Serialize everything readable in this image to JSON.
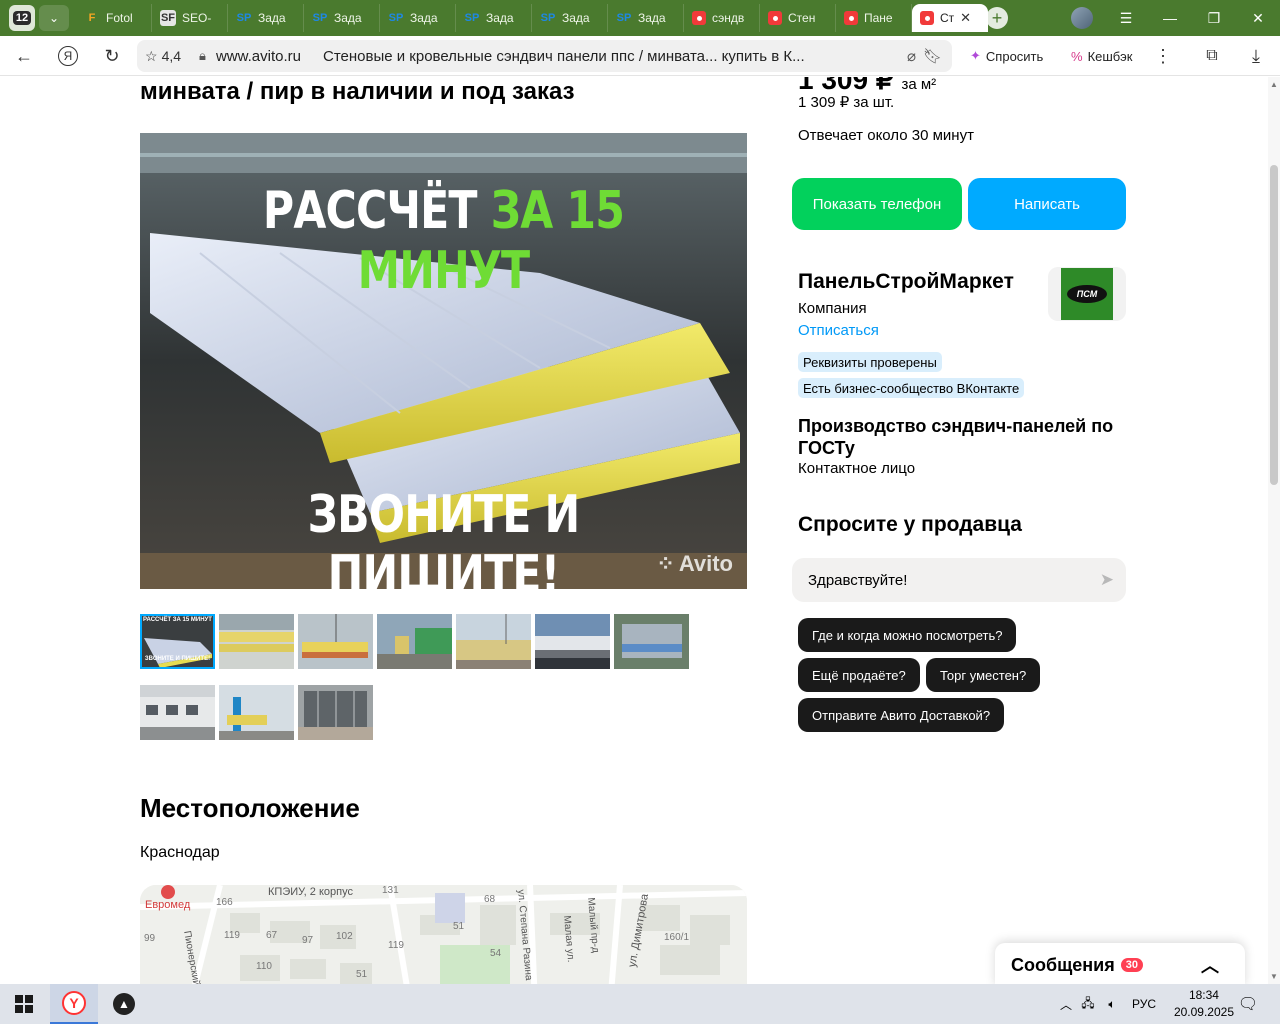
{
  "browser": {
    "tab_count": "12",
    "tabs": [
      {
        "label": "Fotol",
        "fav": "F"
      },
      {
        "label": "SEO-",
        "fav": "SF"
      },
      {
        "label": "Зада",
        "fav": "SP"
      },
      {
        "label": "Зада",
        "fav": "SP"
      },
      {
        "label": "Зада",
        "fav": "SP"
      },
      {
        "label": "Зада",
        "fav": "SP"
      },
      {
        "label": "Зада",
        "fav": "SP"
      },
      {
        "label": "Зада",
        "fav": "SP"
      },
      {
        "label": "сэндв",
        "fav": ""
      },
      {
        "label": "Стен",
        "fav": ""
      },
      {
        "label": "Пане",
        "fav": ""
      },
      {
        "label": "Ст",
        "fav": ""
      }
    ],
    "rating": "4,4",
    "domain": "www.avito.ru",
    "page_title": "Стеновые и кровельные сэндвич панели ппс / минвата... купить в К...",
    "ask_btn": "Спросить",
    "cashback_btn": "Кешбэк"
  },
  "listing": {
    "title_line": "минвата / пир в наличии и под заказ",
    "photo_text_top_white": "РАССЧЁТ",
    "photo_text_top_green": "ЗА 15 МИНУТ",
    "photo_text_bottom": "ЗВОНИТЕ И ПИШИТЕ!",
    "watermark": "Avito",
    "thumb_caption_1": "РАССЧЁТ ЗА 15 МИНУТ",
    "thumb_caption_2": "ЗВОНИТЕ И ПИШИТЕ!"
  },
  "location": {
    "heading": "Местоположение",
    "city": "Краснодар",
    "map_labels": [
      "Евромед",
      "КПЭИУ, 2 корпус",
      "Пионерский",
      "ул. Степана Разина",
      "Малая ул.",
      "Малый пр-д",
      "ул. Димитрова",
      "166",
      "131",
      "68",
      "99",
      "119",
      "67",
      "97",
      "102",
      "119",
      "51",
      "54",
      "110",
      "51",
      "160/1"
    ]
  },
  "sidebar": {
    "price_partial": "1 309 ₽",
    "price_unit_partial": "за м²",
    "price_per_item": "1 309 ₽ за шт.",
    "reply_time": "Отвечает около 30 минут",
    "phone_btn": "Показать телефон",
    "write_btn": "Написать",
    "seller_name": "ПанельСтройМаркет",
    "seller_type": "Компания",
    "unsubscribe": "Отписаться",
    "logo_text": "ПСМ",
    "badge_1": "Реквизиты проверены",
    "badge_2": "Есть бизнес-сообщество ВКонтакте",
    "contact_title": "Производство сэндвич-панелей по ГОСТу",
    "contact_role": "Контактное лицо",
    "ask_heading": "Спросите у продавца",
    "ask_input": "Здравствуйте!",
    "chips": [
      "Где и когда можно посмотреть?",
      "Ещё продаёте?",
      "Торг уместен?",
      "Отправите Авито Доставкой?"
    ]
  },
  "messages": {
    "label": "Сообщения",
    "count": "30"
  },
  "taskbar": {
    "lang": "РУС",
    "time": "18:34",
    "date": "20.09.2025"
  }
}
